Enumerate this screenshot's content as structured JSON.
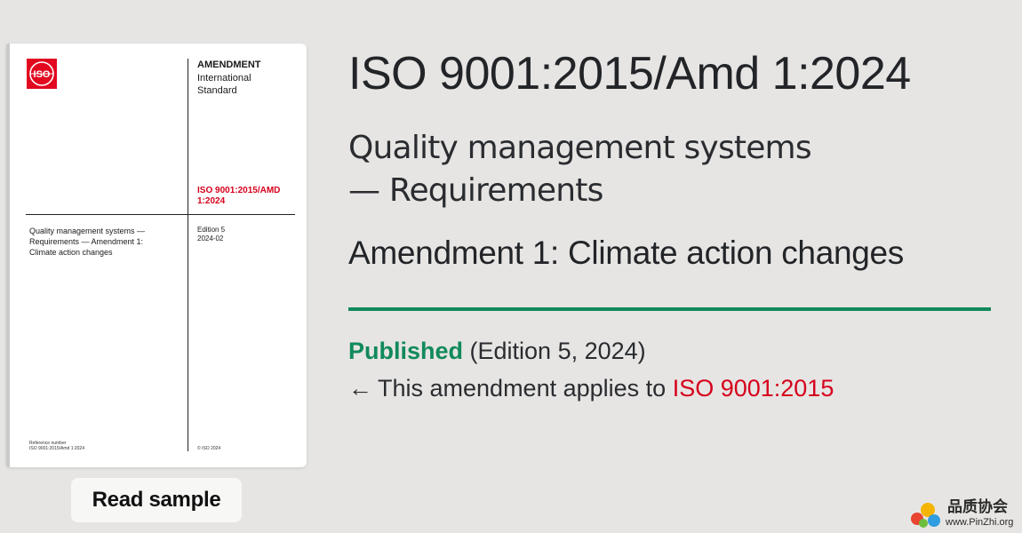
{
  "cover": {
    "logo_text": "ISO",
    "type_label": "AMENDMENT",
    "type_sub": "International Standard",
    "reference": "ISO 9001:2015/AMD 1:2024",
    "title": "Quality management systems — Requirements — Amendment 1: Climate action changes",
    "edition": "Edition 5",
    "date": "2024-02",
    "refnum_label": "Reference number",
    "refnum": "ISO 9001:2015/Amd 1:2024",
    "copyright": "© ISO 2024"
  },
  "read_sample_label": "Read sample",
  "header": {
    "reference": "ISO 9001:2015/Amd 1:2024",
    "title_line1": "Quality management systems",
    "title_line2": "— Requirements",
    "amendment_title": "Amendment 1: Climate action changes"
  },
  "status": {
    "label": "Published",
    "detail": "(Edition 5, 2024)"
  },
  "applies": {
    "arrow": "←",
    "text": "This amendment applies to",
    "link": "ISO 9001:2015"
  },
  "watermark": {
    "cn_text": "品质协会",
    "url": "www.PinZhi.org"
  },
  "colors": {
    "accent_green": "#118a5b",
    "iso_red": "#d6001c",
    "background": "#e6e5e3"
  }
}
